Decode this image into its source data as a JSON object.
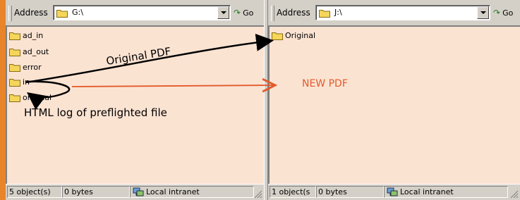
{
  "left_pane": {
    "address_label": "Address",
    "address_value": "G:\\",
    "go_label": "Go",
    "items": [
      "ad_in",
      "ad_out",
      "error",
      "in",
      "original"
    ],
    "status": {
      "objects": "5 object(s)",
      "size": "0 bytes",
      "zone": "Local intranet"
    }
  },
  "right_pane": {
    "address_label": "Address",
    "address_value": "J:\\",
    "go_label": "Go",
    "items": [
      "Original"
    ],
    "status": {
      "objects": "1 object(s",
      "size": "0 bytes",
      "zone": "Local intranet"
    }
  },
  "annotations": {
    "original_pdf": "Original PDF",
    "new_pdf": "NEW PDF",
    "html_log": "HTML log of preflighted file"
  },
  "colors": {
    "background": "#e8842a",
    "list_bg": "#fbe3d2",
    "new_pdf_arrow": "#e25a2a",
    "folder": "#f5d65a"
  },
  "icons": [
    "folder-icon",
    "go-arrow-icon",
    "dropdown-icon",
    "local-intranet-icon",
    "resize-grip-icon"
  ]
}
